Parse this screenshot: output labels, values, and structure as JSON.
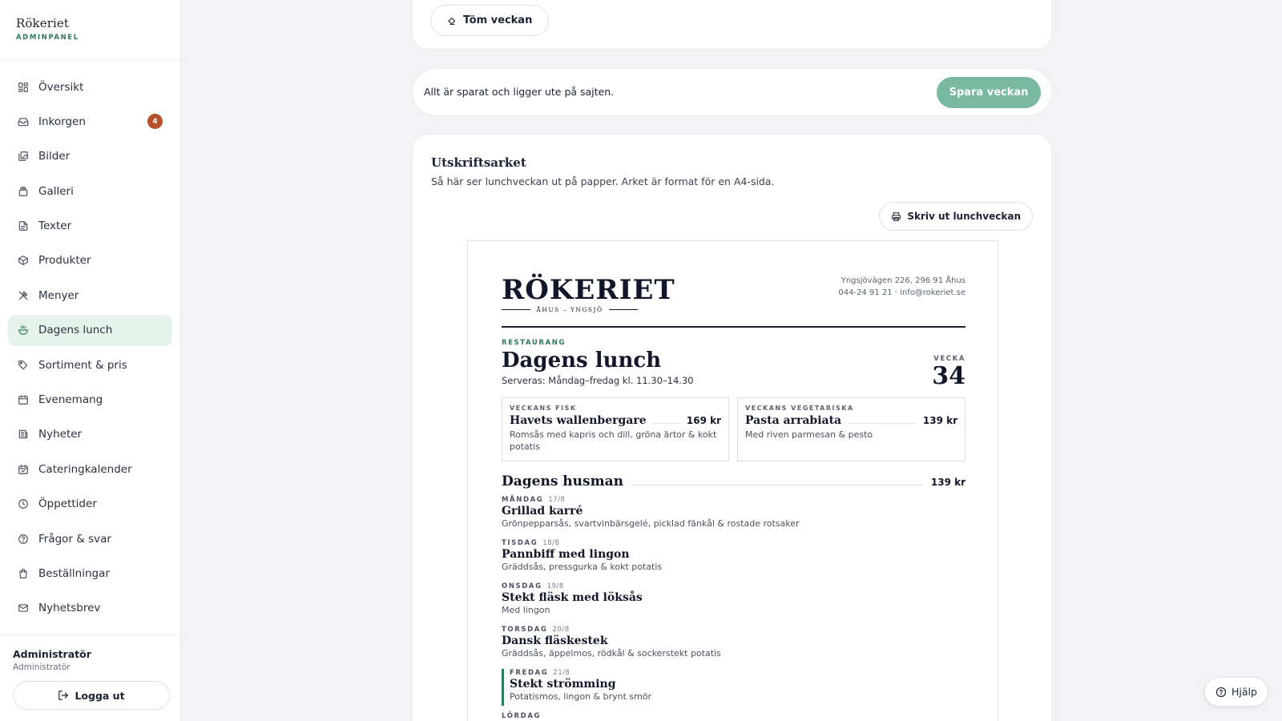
{
  "brand": {
    "name": "Rökeriet",
    "subtitle": "ADMINPANEL"
  },
  "nav": {
    "items": [
      {
        "label": "Översikt",
        "icon": "grid-icon"
      },
      {
        "label": "Inkorgen",
        "icon": "inbox-icon",
        "badge": "4"
      },
      {
        "label": "Bilder",
        "icon": "images-icon"
      },
      {
        "label": "Galleri",
        "icon": "gallery-icon"
      },
      {
        "label": "Texter",
        "icon": "document-icon"
      },
      {
        "label": "Produkter",
        "icon": "box-icon"
      },
      {
        "label": "Menyer",
        "icon": "utensils-icon"
      },
      {
        "label": "Dagens lunch",
        "icon": "bowl-icon",
        "active": true
      },
      {
        "label": "Sortiment & pris",
        "icon": "tag-icon"
      },
      {
        "label": "Evenemang",
        "icon": "calendar-icon"
      },
      {
        "label": "Nyheter",
        "icon": "newspaper-icon"
      },
      {
        "label": "Cateringkalender",
        "icon": "calendar-check-icon"
      },
      {
        "label": "Öppettider",
        "icon": "clock-icon"
      },
      {
        "label": "Frågor & svar",
        "icon": "help-circle-icon"
      },
      {
        "label": "Beställningar",
        "icon": "shopping-bag-icon"
      },
      {
        "label": "Nyhetsbrev",
        "icon": "mail-icon"
      }
    ]
  },
  "user": {
    "name": "Administratör",
    "role": "Administratör",
    "logout_label": "Logga ut"
  },
  "week_card": {
    "clear_label": "Töm veckan"
  },
  "save_bar": {
    "status": "Allt är sparat och ligger ute på sajten.",
    "save_label": "Spara veckan"
  },
  "print": {
    "title": "Utskriftsarket",
    "description": "Så här ser lunchveckan ut på papper. Arket är format för en A4-sida.",
    "print_label": "Skriv ut lunchveckan"
  },
  "sheet": {
    "logo_word": "RÖKERIET",
    "logo_tag": "ÅHUS – YNGSJÖ",
    "address": "Yngsjövägen 226, 296 91 Åhus",
    "contact": "044-24 91 21 · info@rokeriet.se",
    "eyebrow": "RESTAURANG",
    "title": "Dagens lunch",
    "served": "Serveras: Måndag–fredag kl. 11.30–14.30",
    "week_label": "VECKA",
    "week_number": "34",
    "featured": [
      {
        "kicker": "VECKANS FISK",
        "name": "Havets wallenbergare",
        "price": "169 kr",
        "desc": "Romsås med kapris och dill, gröna ärtor & kokt potatis"
      },
      {
        "kicker": "VECKANS VEGETARISKA",
        "name": "Pasta arrabiata",
        "price": "139 kr",
        "desc": "Med riven parmesan & pesto"
      }
    ],
    "husman_title": "Dagens husman",
    "husman_price": "139 kr",
    "days": [
      {
        "day": "MÅNDAG",
        "date": "17/8",
        "dish": "Grillad karré",
        "desc": "Grönpepparsås, svartvinbärsgelé, picklad fänkål & rostade rotsaker"
      },
      {
        "day": "TISDAG",
        "date": "18/8",
        "dish": "Pannbiff med lingon",
        "desc": "Gräddsås, pressgurka & kokt potatis"
      },
      {
        "day": "ONSDAG",
        "date": "19/8",
        "dish": "Stekt fläsk med löksås",
        "desc": "Med lingon"
      },
      {
        "day": "TORSDAG",
        "date": "20/8",
        "dish": "Dansk fläskestek",
        "desc": "Gräddsås, äppelmos, rödkål & sockerstekt potatis"
      },
      {
        "day": "FREDAG",
        "date": "21/8",
        "dish": "Stekt strömming",
        "desc": "Potatismos, lingon & brynt smör",
        "highlight": true
      },
      {
        "day": "LÖRDAG",
        "date": "",
        "dish": "",
        "desc": ""
      }
    ]
  },
  "help": {
    "label": "Hjälp"
  },
  "colors": {
    "accent": "#2e7a5c",
    "active_bg": "#e6f3ec",
    "badge": "#b5512c",
    "save_button": "#7ab9a1"
  }
}
